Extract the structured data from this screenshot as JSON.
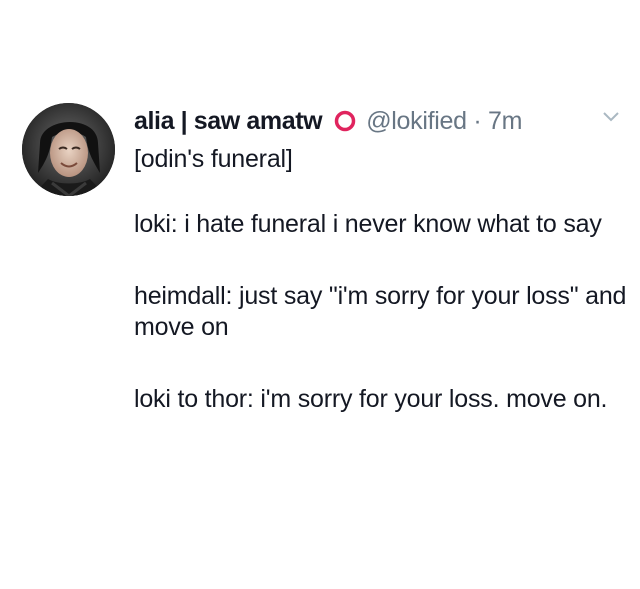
{
  "tweet": {
    "display_name": "alia | saw amatw",
    "badge_icon": "red-ring-icon",
    "badge_color": "#e0245e",
    "handle_time": "@lokified · 7m",
    "menu_icon": "chevron-down-icon",
    "lines": [
      "[odin's funeral]",
      "loki: i hate funeral i never know what to say",
      "heimdall: just say \"i'm sorry for your loss\" and move on",
      "loki to thor: i'm sorry for your loss. move on."
    ]
  },
  "colors": {
    "text": "#141823",
    "muted": "#687684",
    "background": "#ffffff"
  }
}
